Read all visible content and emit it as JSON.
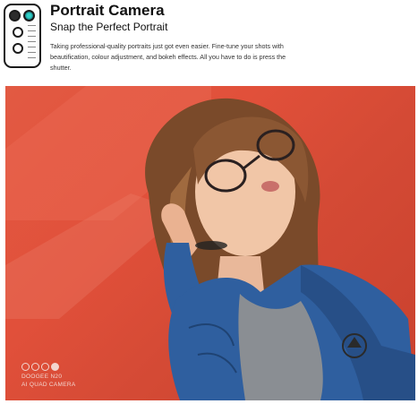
{
  "header": {
    "title": "Portrait Camera",
    "subtitle": "Snap the Perfect Portrait",
    "description": "Taking professional-quality portraits just got even easier. Fine-tune your shots with beautification, colour adjustment, and bokeh effects. All you have to do is press the shutter."
  },
  "camera_icon": "camera-module-icon",
  "photo": {
    "watermark_line1": "DOOGEE N20",
    "watermark_line2": "AI QUAD CAMERA"
  },
  "colors": {
    "background_red": "#e1503a",
    "jacket_blue": "#2f5f9f",
    "lens_teal": "#2fd1c7"
  }
}
